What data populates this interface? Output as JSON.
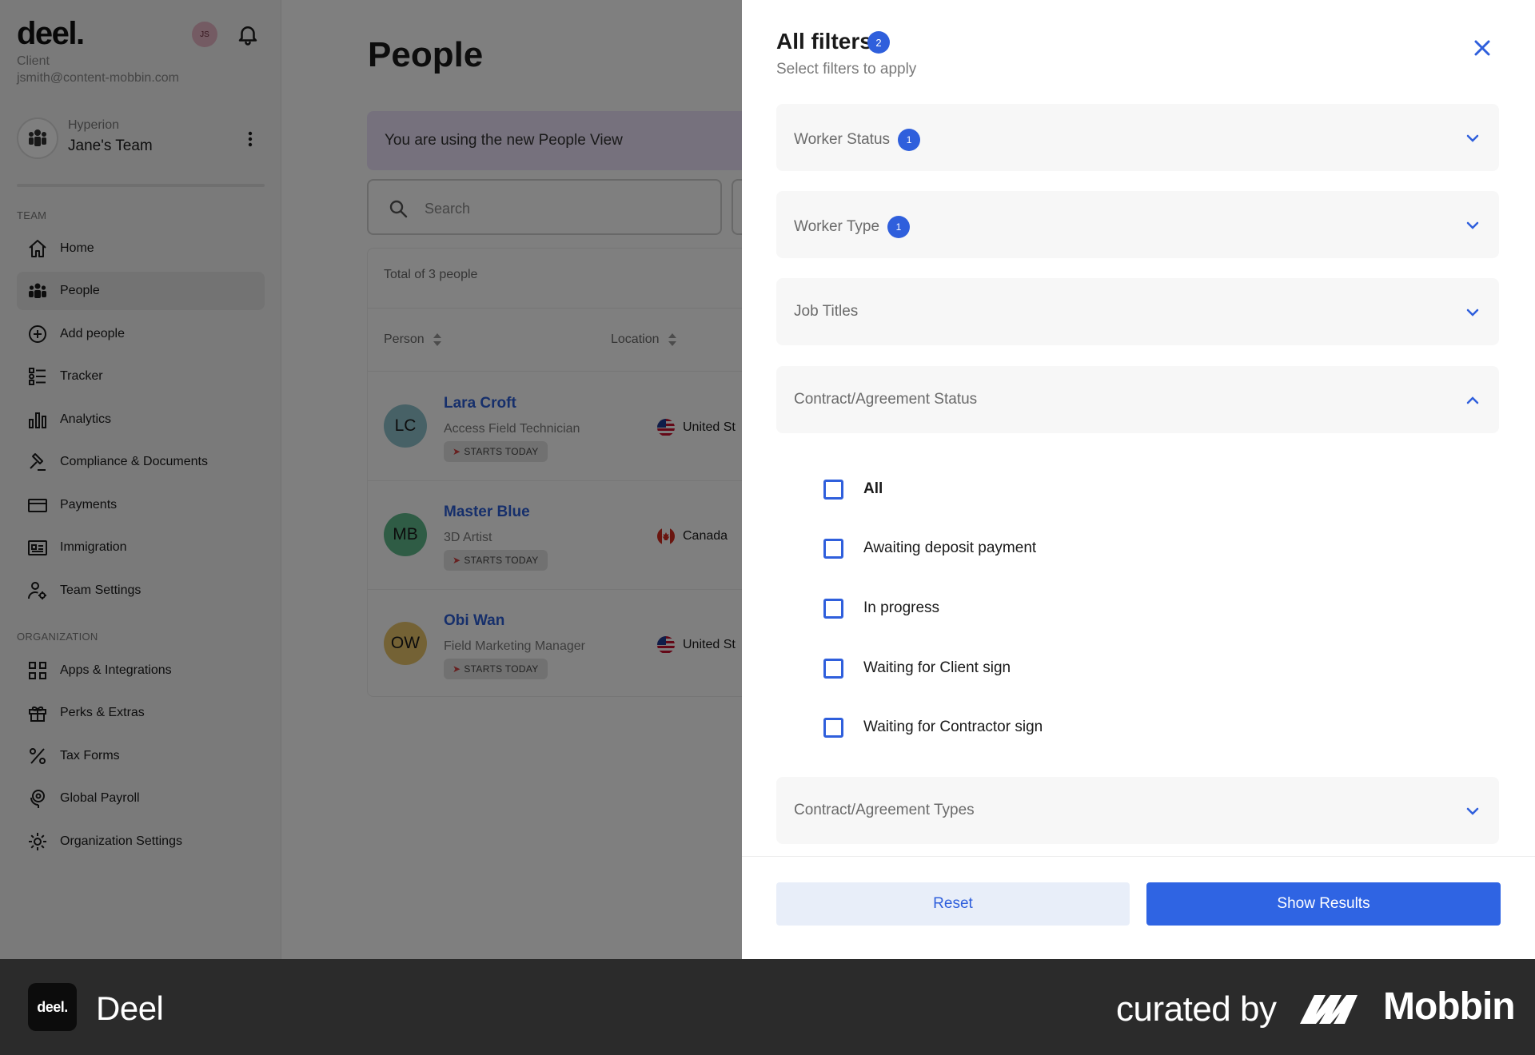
{
  "sidebar": {
    "logo": "deel.",
    "role": "Client",
    "email": "jsmith@content-mobbin.com",
    "avatar_initials": "JS",
    "team": {
      "org": "Hyperion",
      "name": "Jane's Team"
    },
    "team_section_label": "TEAM",
    "org_section_label": "ORGANIZATION",
    "team_items": [
      {
        "label": "Home",
        "icon": "home-icon"
      },
      {
        "label": "People",
        "icon": "people-icon",
        "active": true
      },
      {
        "label": "Add people",
        "icon": "plus-circle-icon"
      },
      {
        "label": "Tracker",
        "icon": "tracker-icon"
      },
      {
        "label": "Analytics",
        "icon": "bar-chart-icon"
      },
      {
        "label": "Compliance & Documents",
        "icon": "gavel-icon"
      },
      {
        "label": "Payments",
        "icon": "credit-card-icon"
      },
      {
        "label": "Immigration",
        "icon": "id-card-icon"
      },
      {
        "label": "Team Settings",
        "icon": "user-gear-icon"
      }
    ],
    "org_items": [
      {
        "label": "Apps & Integrations",
        "icon": "apps-grid-icon"
      },
      {
        "label": "Perks & Extras",
        "icon": "gift-icon"
      },
      {
        "label": "Tax Forms",
        "icon": "percent-icon"
      },
      {
        "label": "Global Payroll",
        "icon": "globe-pin-icon"
      },
      {
        "label": "Organization Settings",
        "icon": "gear-icon"
      }
    ]
  },
  "main": {
    "title": "People",
    "banner": "You are using the new People View",
    "search_placeholder": "Search",
    "total": "Total of 3 people",
    "columns": [
      "Person",
      "Location"
    ],
    "people": [
      {
        "initials": "LC",
        "name": "Lara Croft",
        "title": "Access Field Technician",
        "badge": "STARTS TODAY",
        "location": "United St",
        "avatar_color": "#8fc3cc",
        "flag": "us"
      },
      {
        "initials": "MB",
        "name": "Master Blue",
        "title": "3D Artist",
        "badge": "STARTS TODAY",
        "location": "Canada",
        "avatar_color": "#5fb98a",
        "flag": "ca"
      },
      {
        "initials": "OW",
        "name": "Obi Wan",
        "title": "Field Marketing Manager",
        "badge": "STARTS TODAY",
        "location": "United St",
        "avatar_color": "#e8c56a",
        "flag": "us"
      }
    ]
  },
  "drawer": {
    "title": "All filters",
    "count": "2",
    "subtitle": "Select filters to apply",
    "sections": [
      {
        "label": "Worker Status",
        "count": "1",
        "expanded": false
      },
      {
        "label": "Worker Type",
        "count": "1",
        "expanded": false
      },
      {
        "label": "Job Titles",
        "expanded": false
      },
      {
        "label": "Contract/Agreement Status",
        "expanded": true
      },
      {
        "label": "Contract/Agreement Types",
        "expanded": false
      }
    ],
    "options": [
      {
        "label": "All",
        "checked": false
      },
      {
        "label": "Awaiting deposit payment",
        "checked": false
      },
      {
        "label": "In progress",
        "checked": false
      },
      {
        "label": "Waiting for Client sign",
        "checked": false
      },
      {
        "label": "Waiting for Contractor sign",
        "checked": false
      }
    ],
    "reset_label": "Reset",
    "show_label": "Show Results"
  },
  "brand_bar": {
    "app_icon_text": "deel.",
    "app_name": "Deel",
    "curated_by": "curated by",
    "mobbin": "Mobbin"
  },
  "colors": {
    "accent": "#2f64e3",
    "link": "#2c5fd6",
    "banner": "#ece3fb",
    "overlay": "rgba(0,0,0,0.5)"
  }
}
